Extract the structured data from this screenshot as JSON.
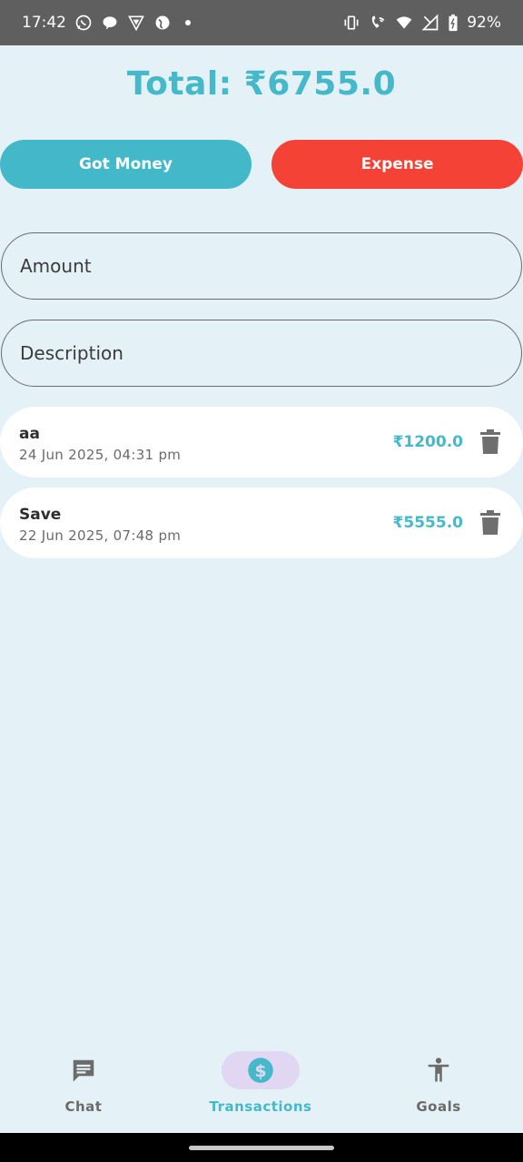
{
  "status_bar": {
    "time": "17:42",
    "left_icons": [
      "whatsapp-icon",
      "chat-bubble-icon",
      "vpn-shield-icon",
      "globe-icon"
    ],
    "battery": "92%"
  },
  "header": {
    "total_text": "Total: ₹6755.0"
  },
  "actions": {
    "got_money_label": "Got Money",
    "expense_label": "Expense",
    "got_money_color": "#43b8c9",
    "expense_color": "#f44336"
  },
  "form": {
    "amount_placeholder": "Amount",
    "description_placeholder": "Description"
  },
  "transactions": [
    {
      "title": "aa",
      "date": "24 Jun 2025, 04:31 pm",
      "amount": "₹1200.0"
    },
    {
      "title": "Save",
      "date": "22 Jun 2025, 07:48 pm",
      "amount": "₹5555.0"
    }
  ],
  "nav": {
    "items": [
      {
        "label": "Chat",
        "icon": "chat-icon",
        "active": false
      },
      {
        "label": "Transactions",
        "icon": "dollar-icon",
        "active": true
      },
      {
        "label": "Goals",
        "icon": "accessibility-icon",
        "active": false
      }
    ]
  },
  "colors": {
    "accent": "#45b8c9",
    "background": "#e4f2f7",
    "active_nav_pill": "#e2d7f3"
  }
}
